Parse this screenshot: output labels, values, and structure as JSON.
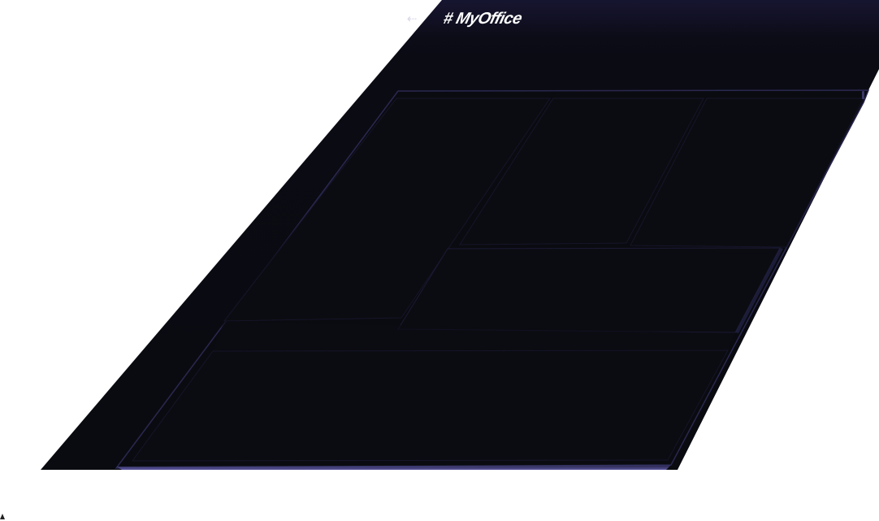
{
  "header": {
    "back_icon": "arrow-left-icon",
    "back_glyph": "⇠",
    "title": "# MyOffice"
  },
  "colors": {
    "background": "#0a0b10",
    "panel_border": "#2e2c55",
    "panel_fill": "#0b0c12",
    "title_text": "#ffffff"
  }
}
